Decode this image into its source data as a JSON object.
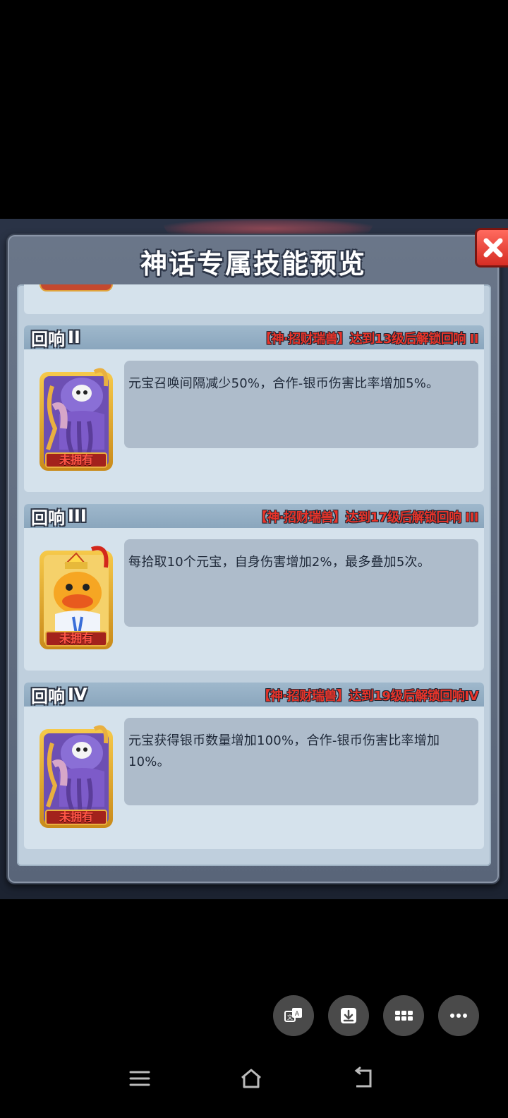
{
  "dialog": {
    "title": "神话专属技能预览"
  },
  "cards": [
    {
      "echo_prefix": "回响",
      "echo_level": "II",
      "unlock_text": "【神·招财瑞兽】达到13级后解锁回响 II",
      "owned_tag": "未拥有",
      "portrait_icon": "purple-octopus-skull-portrait-icon",
      "description": "元宝召唤间隔减少50%，合作-银币伤害比率增加5%。"
    },
    {
      "echo_prefix": "回响",
      "echo_level": "III",
      "unlock_text": "【神·招财瑞兽】达到17级后解锁回响 III",
      "owned_tag": "未拥有",
      "portrait_icon": "golden-duck-king-portrait-icon",
      "description": "每拾取10个元宝，自身伤害增加2%，最多叠加5次。"
    },
    {
      "echo_prefix": "回响",
      "echo_level": "IV",
      "unlock_text": "【神·招财瑞兽】达到19级后解锁回响IV",
      "owned_tag": "未拥有",
      "portrait_icon": "purple-octopus-skull-portrait-icon",
      "description": "元宝获得银币数量增加100%，合作-银币伤害比率增加10%。"
    }
  ],
  "floating_actions": [
    {
      "icon": "translate-icon"
    },
    {
      "icon": "download-icon"
    },
    {
      "icon": "grid-apps-icon"
    },
    {
      "icon": "more-dots-icon"
    }
  ],
  "navbar": {
    "items": [
      "menu-icon",
      "home-icon",
      "back-icon"
    ]
  },
  "colors": {
    "dialog_bg": "#6a7689",
    "panel_bg": "#bfcfdd",
    "card_bg": "#d5e2ec",
    "card_header": "#9fb8cc",
    "unlock_red": "#e8342a",
    "close_red": "#d62d24"
  }
}
